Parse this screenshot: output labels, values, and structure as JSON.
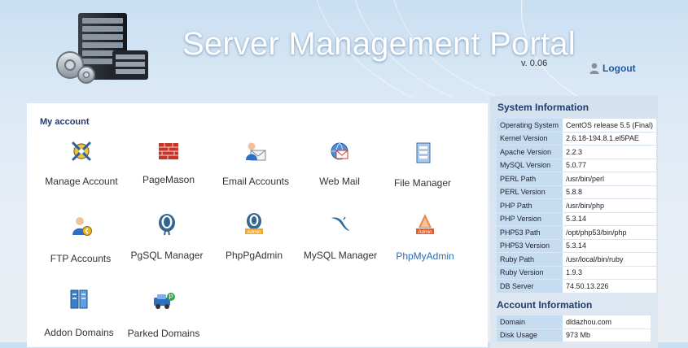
{
  "header": {
    "title": "Server Management Portal",
    "version": "v. 0.06",
    "logout_label": "Logout"
  },
  "my_account": {
    "heading": "My account",
    "tools": [
      {
        "label": "Manage Account",
        "icon": "manage-account-icon"
      },
      {
        "label": "PageMason",
        "icon": "pagemason-icon"
      },
      {
        "label": "Email Accounts",
        "icon": "email-accounts-icon"
      },
      {
        "label": "Web Mail",
        "icon": "web-mail-icon"
      },
      {
        "label": "File Manager",
        "icon": "file-manager-icon"
      },
      {
        "label": "FTP Accounts",
        "icon": "ftp-accounts-icon"
      },
      {
        "label": "PgSQL Manager",
        "icon": "pgsql-manager-icon"
      },
      {
        "label": "PhpPgAdmin",
        "icon": "phppgadmin-icon"
      },
      {
        "label": "MySQL Manager",
        "icon": "mysql-manager-icon"
      },
      {
        "label": "PhpMyAdmin",
        "icon": "phpmyadmin-icon"
      },
      {
        "label": "Addon Domains",
        "icon": "addon-domains-icon"
      },
      {
        "label": "Parked Domains",
        "icon": "parked-domains-icon"
      }
    ]
  },
  "system_info": {
    "heading": "System Information",
    "rows": [
      {
        "key": "Operating System",
        "value": "CentOS release 5.5 (Final)"
      },
      {
        "key": "Kernel Version",
        "value": "2.6.18-194.8.1.el5PAE"
      },
      {
        "key": "Apache Version",
        "value": "2.2.3"
      },
      {
        "key": "MySQL Version",
        "value": "5.0.77"
      },
      {
        "key": "PERL Path",
        "value": "/usr/bin/perl"
      },
      {
        "key": "PERL Version",
        "value": "5.8.8"
      },
      {
        "key": "PHP Path",
        "value": "/usr/bin/php"
      },
      {
        "key": "PHP Version",
        "value": "5.3.14"
      },
      {
        "key": "PHP53 Path",
        "value": "/opt/php53/bin/php"
      },
      {
        "key": "PHP53 Version",
        "value": "5.3.14"
      },
      {
        "key": "Ruby Path",
        "value": "/usr/local/bin/ruby"
      },
      {
        "key": "Ruby Version",
        "value": "1.9.3"
      },
      {
        "key": "DB Server",
        "value": "74.50.13.226"
      }
    ]
  },
  "account_info": {
    "heading": "Account Information",
    "rows": [
      {
        "key": "Domain",
        "value": "dldazhou.com"
      },
      {
        "key": "Disk Usage",
        "value": "973 Mb"
      }
    ]
  },
  "colors": {
    "heading": "#1f3a6b",
    "link": "#2a6cb0",
    "key_cell": "#c6dcf0",
    "logout": "#1d5a9e"
  }
}
